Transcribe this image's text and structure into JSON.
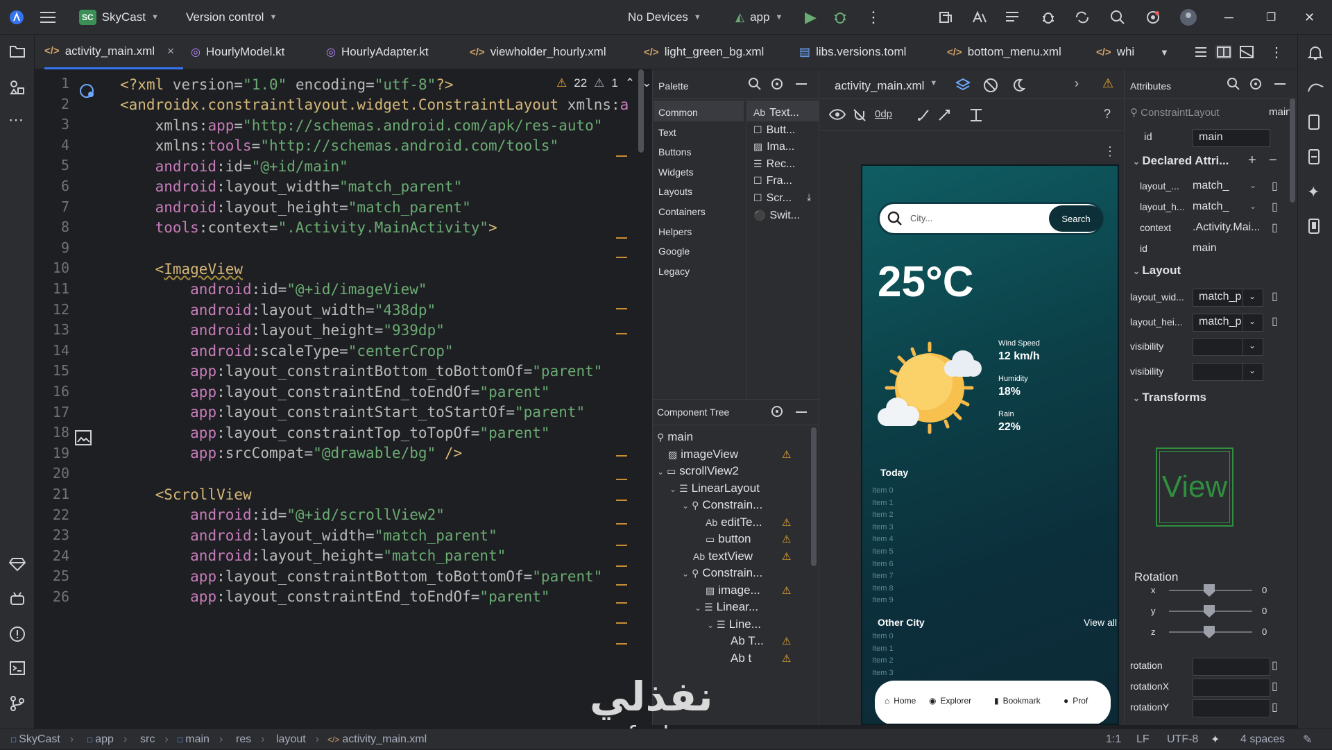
{
  "titlebar": {
    "project_badge": "SC",
    "project": "SkyCast",
    "vcs": "Version control",
    "devices": "No Devices",
    "run_config": "app"
  },
  "tabs": [
    "activity_main.xml",
    "HourlyModel.kt",
    "HourlyAdapter.kt",
    "viewholder_hourly.xml",
    "light_green_bg.xml",
    "libs.versions.toml",
    "bottom_menu.xml",
    "white_f"
  ],
  "editor": {
    "warnings": "22",
    "weak_warnings": "1",
    "line_numbers": [
      "1",
      "2",
      "3",
      "4",
      "5",
      "6",
      "7",
      "8",
      "9",
      "10",
      "11",
      "12",
      "13",
      "14",
      "15",
      "16",
      "17",
      "18",
      "19",
      "20",
      "21",
      "22",
      "23",
      "24",
      "25",
      "26"
    ]
  },
  "palette": {
    "title": "Palette",
    "categories": [
      "Common",
      "Text",
      "Buttons",
      "Widgets",
      "Layouts",
      "Containers",
      "Helpers",
      "Google",
      "Legacy"
    ],
    "items": [
      "Text...",
      "Butt...",
      "Ima...",
      "Rec...",
      "Fra...",
      "Scr...",
      "Swit..."
    ],
    "item_prefix": "Ab"
  },
  "tree": {
    "title": "Component Tree",
    "nodes": [
      "main",
      "imageView",
      "scrollView2",
      "LinearLayout",
      "Constrain...",
      "editTe...",
      "button",
      "textView",
      "Constrain...",
      "image...",
      "Linear...",
      "Line...",
      "Ab T...",
      "Ab t"
    ]
  },
  "design": {
    "file": "activity_main.xml",
    "dp": "0dp",
    "phone": {
      "search_placeholder": "City...",
      "search_button": "Search",
      "temperature": "25°C",
      "wind_label": "Wind Speed",
      "wind_value": "12 km/h",
      "humidity_label": "Humidity",
      "humidity_value": "18%",
      "rain_label": "Rain",
      "rain_value": "22%",
      "today": "Today",
      "today_items": [
        "Item 0",
        "Item 1",
        "Item 2",
        "Item 3",
        "Item 4",
        "Item 5",
        "Item 6",
        "Item 7",
        "Item 8",
        "Item 9"
      ],
      "other_city": "Other City",
      "view_all": "View all",
      "other_items": [
        "Item 0",
        "Item 1",
        "Item 2",
        "Item 3"
      ],
      "nav": [
        "Home",
        "Explorer",
        "Bookmark",
        "Prof"
      ]
    }
  },
  "attributes": {
    "title": "Attributes",
    "component": "ConstraintLayout",
    "component_id": "main",
    "id_label": "id",
    "id_value": "main",
    "declared": "Declared Attri...",
    "declared_rows": [
      {
        "label": "layout_...",
        "value": "match_"
      },
      {
        "label": "layout_h...",
        "value": "match_"
      },
      {
        "label": "context",
        "value": ".Activity.Mai..."
      },
      {
        "label": "id",
        "value": "main"
      }
    ],
    "layout": "Layout",
    "layout_rows": [
      {
        "label": "layout_wid...",
        "value": "match_p"
      },
      {
        "label": "layout_hei...",
        "value": "match_p"
      },
      {
        "label": "visibility",
        "value": ""
      },
      {
        "label": "visibility",
        "value": ""
      }
    ],
    "transforms": "Transforms",
    "preview": "View",
    "rotation": "Rotation",
    "axes": [
      {
        "label": "x",
        "value": "0"
      },
      {
        "label": "y",
        "value": "0"
      },
      {
        "label": "z",
        "value": "0"
      }
    ],
    "rotation_fields": [
      "rotation",
      "rotationX",
      "rotationY"
    ]
  },
  "statusbar": {
    "crumbs": [
      "SkyCast",
      "app",
      "src",
      "main",
      "res",
      "layout",
      "activity_main.xml"
    ],
    "position": "1:1",
    "line_sep": "LF",
    "encoding": "UTF-8",
    "indent": "4 spaces"
  },
  "watermark": {
    "arabic": "نفذلي",
    "domain": "nafezly.com"
  }
}
